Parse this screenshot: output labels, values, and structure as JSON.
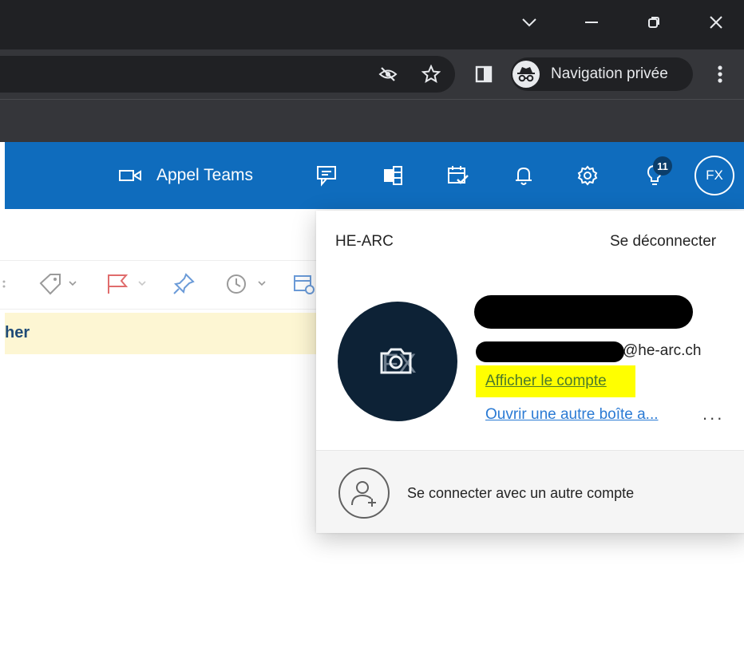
{
  "browser": {
    "window_controls": {
      "tabs_menu_icon": "chevron-down-icon",
      "minimize_icon": "minimize-icon",
      "restore_icon": "restore-icon",
      "close_icon": "close-icon"
    },
    "toolbar": {
      "omnibox_icons": [
        "eye-off-icon",
        "star-icon"
      ],
      "side_panel_icon": "side-panel-icon",
      "private_label": "Navigation privée",
      "incognito_icon": "incognito-icon",
      "menu_icon": "kebab-menu-icon"
    }
  },
  "header": {
    "accent_color": "#0f6cbd",
    "teams_call_label": "Appel Teams",
    "icons": [
      "teams-video-icon",
      "chat-icon",
      "office-apps-icon",
      "calendar-check-icon",
      "bell-icon",
      "gear-icon",
      "lightbulb-icon"
    ],
    "tips_badge": "11",
    "avatar_initials": "FX"
  },
  "background": {
    "ribbon_icons": [
      "tag-icon",
      "flag-icon",
      "pin-icon",
      "clock-icon",
      "sweep-icon"
    ],
    "notice_fragment": "her"
  },
  "account_card": {
    "organization": "HE-ARC",
    "sign_out": "Se déconnecter",
    "email_suffix": "@he-arc.ch",
    "view_account": "Afficher le compte",
    "open_other_mailbox": "Ouvrir une autre boîte a...",
    "more_options": "...",
    "sign_in_other": "Se connecter avec un autre compte",
    "highlight_color": "#ffff00"
  }
}
